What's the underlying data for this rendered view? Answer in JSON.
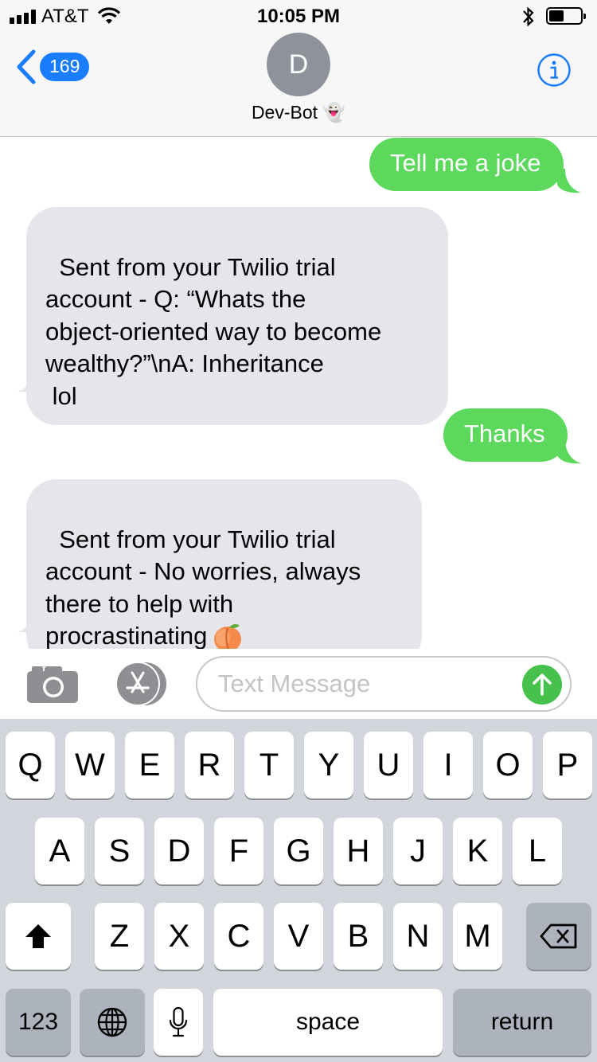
{
  "status_bar": {
    "carrier": "AT&T",
    "time": "10:05 PM",
    "icons": [
      "signal-icon",
      "wifi-icon",
      "bluetooth-icon",
      "battery-icon"
    ]
  },
  "nav": {
    "back_count": "169",
    "avatar_initial": "D",
    "contact_name": "Dev-Bot 👻",
    "info_icon": "info-icon"
  },
  "messages": [
    {
      "direction": "outgoing",
      "text": "Tell me a joke"
    },
    {
      "direction": "incoming",
      "text": "Sent from your Twilio trial\naccount - Q: “Whats the\nobject-oriented way to become\nwealthy?”\\nA: Inheritance\n lol"
    },
    {
      "direction": "outgoing",
      "text": "Thanks"
    },
    {
      "direction": "incoming",
      "text": "Sent from your Twilio trial\naccount - No worries, always\nthere to help with\nprocrastinating",
      "emoji": "peach-emoji"
    }
  ],
  "input": {
    "placeholder": "Text Message",
    "value": ""
  },
  "keyboard": {
    "row1": [
      "Q",
      "W",
      "E",
      "R",
      "T",
      "Y",
      "U",
      "I",
      "O",
      "P"
    ],
    "row2": [
      "A",
      "S",
      "D",
      "F",
      "G",
      "H",
      "J",
      "K",
      "L"
    ],
    "row3": [
      "Z",
      "X",
      "C",
      "V",
      "B",
      "N",
      "M"
    ],
    "numbers_label": "123",
    "space_label": "space",
    "return_label": "return"
  },
  "colors": {
    "outgoing_bubble": "#5cd85c",
    "incoming_bubble": "#e6e5eb",
    "accent": "#1a7dff",
    "send_button": "#46c14c"
  }
}
